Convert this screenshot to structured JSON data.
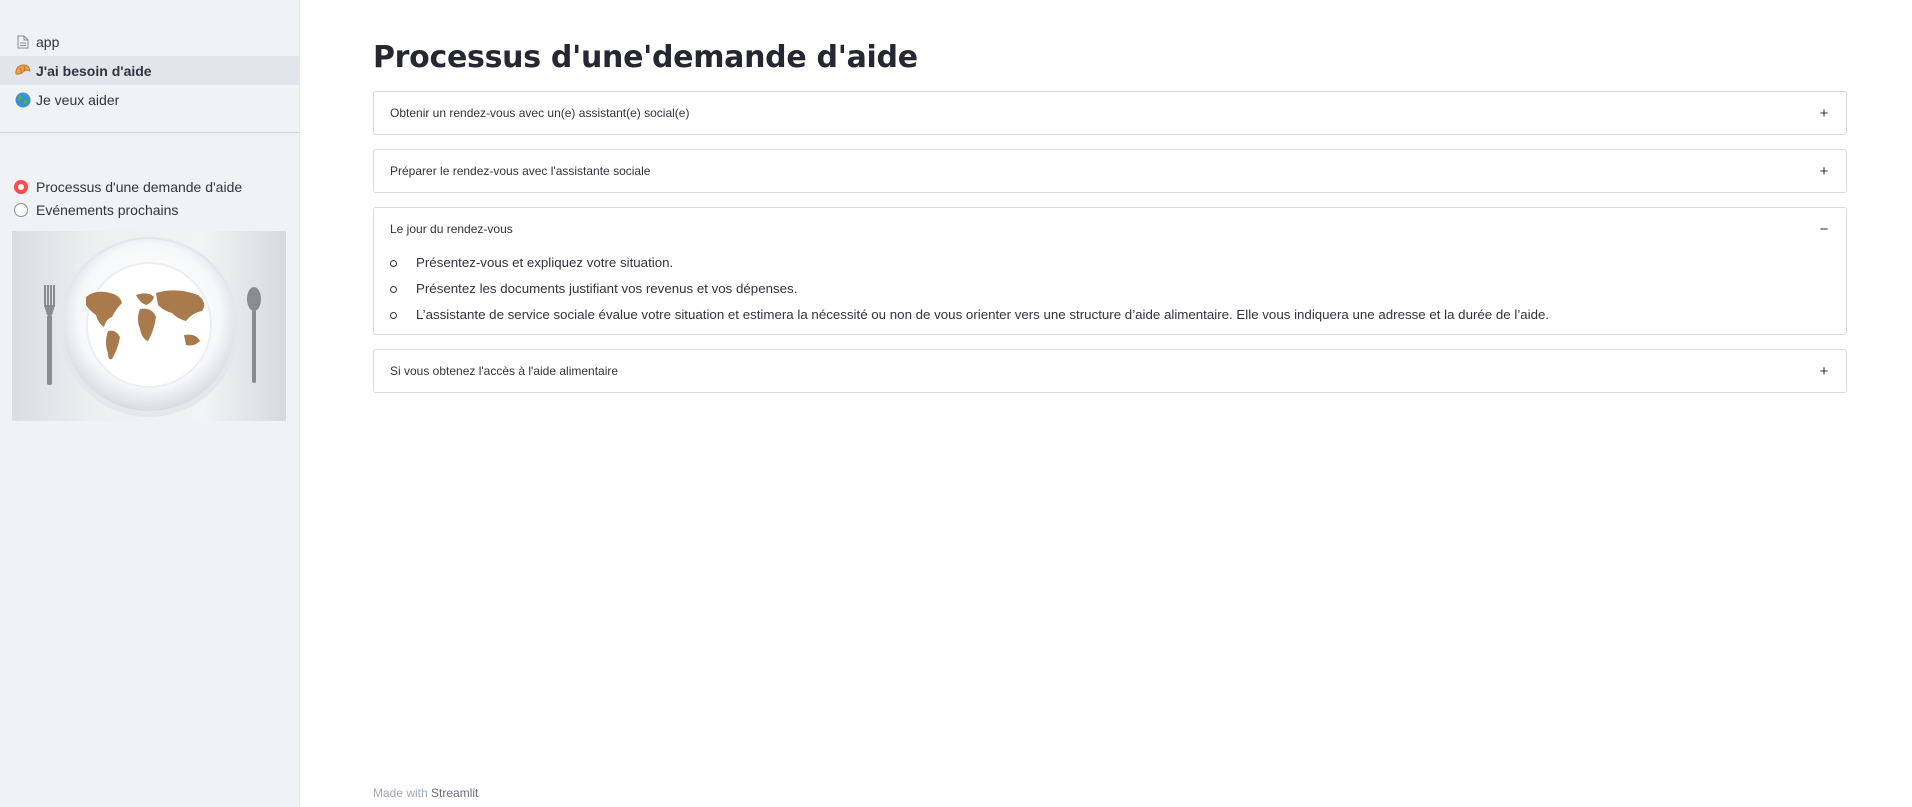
{
  "sidebar": {
    "nav": [
      {
        "label": "app",
        "icon": "document-icon",
        "active": false
      },
      {
        "label": "J'ai besoin d'aide",
        "icon": "croissant-icon",
        "active": true
      },
      {
        "label": "Je veux aider",
        "icon": "globe-icon",
        "active": false
      }
    ],
    "radio": {
      "options": [
        "Processus d'une demande d'aide",
        "Evénements prochains"
      ],
      "selected": "Processus d'une demande d'aide"
    }
  },
  "main": {
    "title": "Processus d'une'demande d'aide",
    "expanders": [
      {
        "label": "Obtenir un rendez-vous avec un(e) assistant(e) social(e)",
        "expanded": false,
        "toggle": "+"
      },
      {
        "label": "Préparer le rendez-vous avec l'assistante sociale",
        "expanded": false,
        "toggle": "+"
      },
      {
        "label": "Le jour du rendez-vous",
        "expanded": true,
        "toggle": "−",
        "items": [
          "Présentez-vous et expliquez votre situation.",
          "Présentez les documents justifiant vos revenus et vos dépenses.",
          "L’assistante de service sociale évalue votre situation et estimera la nécessité ou non de vous orienter vers une structure d’aide alimentaire. Elle vous indiquera une adresse et la durée de l’aide."
        ]
      },
      {
        "label": "Si vous obtenez l'accès à l'aide alimentaire",
        "expanded": false,
        "toggle": "+"
      }
    ]
  },
  "footer": {
    "prefix": "Made with",
    "brand": "Streamlit"
  },
  "colors": {
    "accent": "#ff4b4b",
    "sidebar_bg": "#f0f2f6",
    "text": "#31333f"
  }
}
